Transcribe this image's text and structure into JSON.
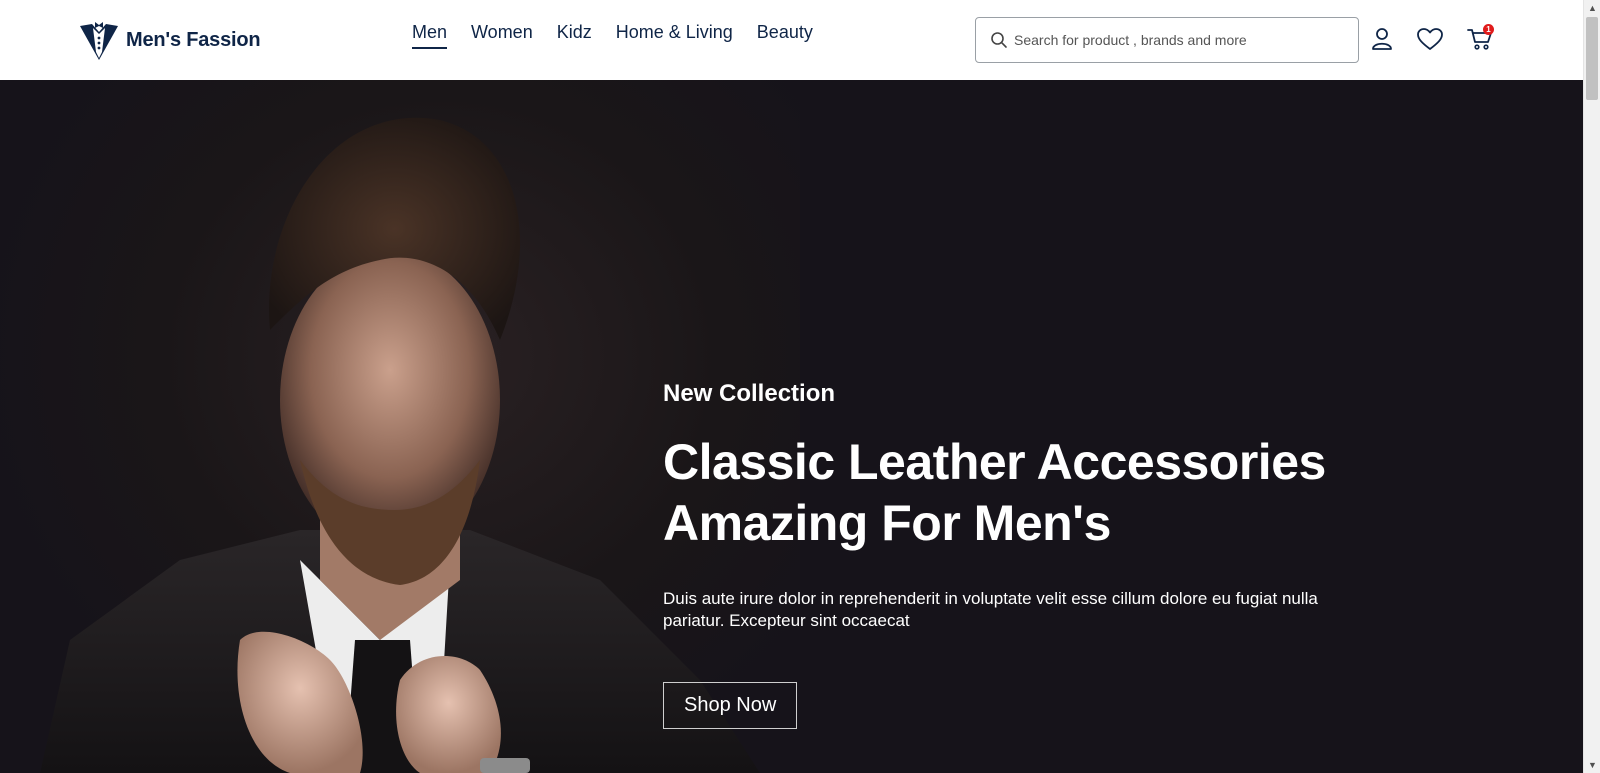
{
  "brand": {
    "name": "Men's Fassion",
    "icon": "tuxedo-icon"
  },
  "nav": {
    "items": [
      {
        "label": "Men",
        "active": true
      },
      {
        "label": "Women",
        "active": false
      },
      {
        "label": "Kidz",
        "active": false
      },
      {
        "label": "Home & Living",
        "active": false
      },
      {
        "label": "Beauty",
        "active": false
      }
    ]
  },
  "search": {
    "placeholder": "Search for product , brands and more",
    "value": "",
    "icon": "search-icon"
  },
  "header_icons": {
    "account": "user-icon",
    "wishlist": "heart-icon",
    "cart": "cart-icon",
    "cart_count": "1"
  },
  "hero": {
    "eyebrow": "New Collection",
    "title_line1": "Classic Leather Accessories",
    "title_line2": "Amazing For Men's",
    "description": "Duis aute irure dolor in reprehenderit in voluptate velit esse cillum dolore eu fugiat nulla pariatur. Excepteur sint occaecat",
    "cta_label": "Shop Now"
  },
  "colors": {
    "brand_navy": "#0f2547",
    "hero_bg": "#16131a",
    "badge_red": "#e01b1b"
  }
}
